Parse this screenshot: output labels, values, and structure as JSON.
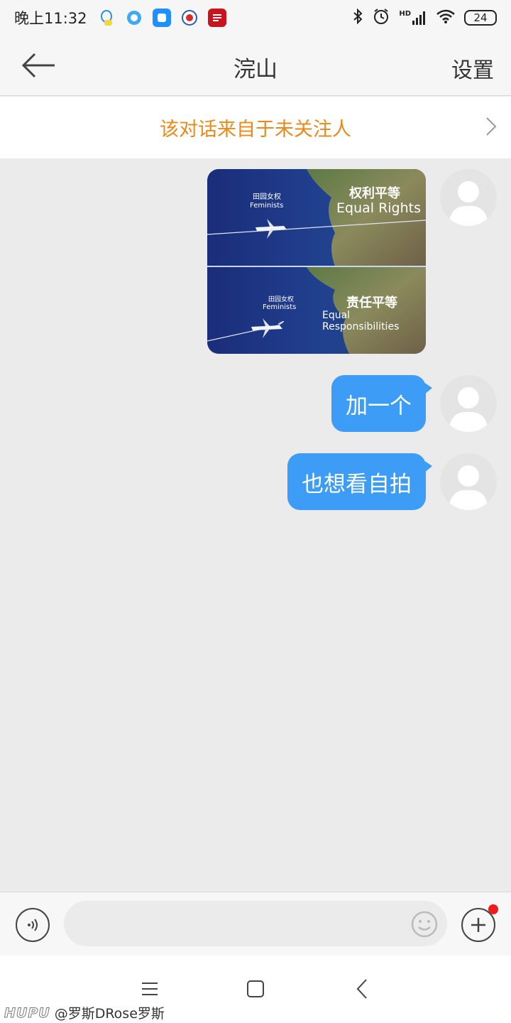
{
  "status_bar": {
    "time": "晚上11:32",
    "hd_label": "HD",
    "battery": "24"
  },
  "header": {
    "back_icon": "arrow-left-icon",
    "title": "浣山",
    "settings_label": "设置"
  },
  "banner": {
    "text": "该对话来自于未关注人"
  },
  "messages": [
    {
      "type": "image",
      "image_texts": {
        "top_cn": "权利平等",
        "top_en": "Equal Rights",
        "bottom_cn": "责任平等",
        "bottom_en": "Equal Responsibilities",
        "plane_cn": "田园女权",
        "plane_en": "Feminists"
      }
    },
    {
      "type": "text",
      "text": "加一个"
    },
    {
      "type": "text",
      "text": "也想看自拍"
    }
  ],
  "input_bar": {
    "placeholder": ""
  },
  "watermark": {
    "logo": "HUPU",
    "user": "@罗斯DRose罗斯"
  },
  "colors": {
    "bubble": "#3d9cf5",
    "banner_text": "#e8891a",
    "notification_dot": "#ee1c1c"
  }
}
